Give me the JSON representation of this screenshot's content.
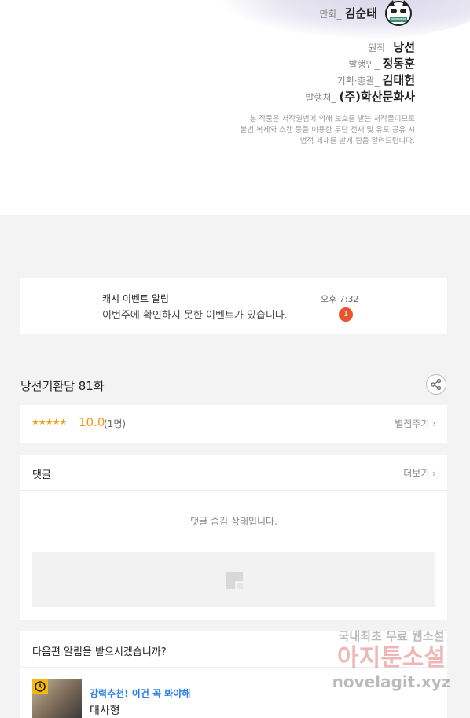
{
  "credits": [
    {
      "role": "만화_",
      "name": "김순태"
    },
    {
      "role": "원작_",
      "name": "낭선"
    },
    {
      "role": "발행인_",
      "name": "정동훈"
    },
    {
      "role": "기획·총괄_",
      "name": "김태헌"
    },
    {
      "role": "발행처_",
      "name": "(주)학산문화사"
    }
  ],
  "copyright": [
    "본 작품은 저작권법에 의해 보호를 받는 저작물이므로",
    "불법 복제와 스캔 등을 이용한 무단 전재 및 유포·공유 시",
    "법적 제재를 받게 됨을 알려드립니다."
  ],
  "notice": {
    "title": "캐시 이벤트 알림",
    "message": "이번주에 확인하지 못한 이벤트가 있습니다.",
    "time": "오후 7:32",
    "badge": "1"
  },
  "episode": {
    "title": "낭선기환담 81화"
  },
  "rating": {
    "stars": "★★★★★",
    "score": "10.0",
    "count": "(1명)",
    "rate_link": "별점주기 ›"
  },
  "comments": {
    "title": "댓글",
    "more_link": "더보기 ›",
    "hidden_message": "댓글 숨김 상태입니다."
  },
  "next_alert": {
    "title": "다음편 알림을 받으시겠습니까?",
    "recommend_label": "강력추천! 이건 꼭 봐야해",
    "recommend_title": "대사형"
  },
  "watermark": {
    "line1": "국내최초 무료 웹소설",
    "line2": "아지툰소설",
    "line3": "novelagit.xyz"
  },
  "colors": {
    "accent_orange": "#f19a16",
    "badge_red": "#e8532e",
    "link_blue": "#2b7de9",
    "background": "#f3f3f3"
  },
  "icons": [
    "author-emblem-icon",
    "share-icon",
    "chevron-right-icon",
    "image-placeholder-icon",
    "clock-icon"
  ]
}
